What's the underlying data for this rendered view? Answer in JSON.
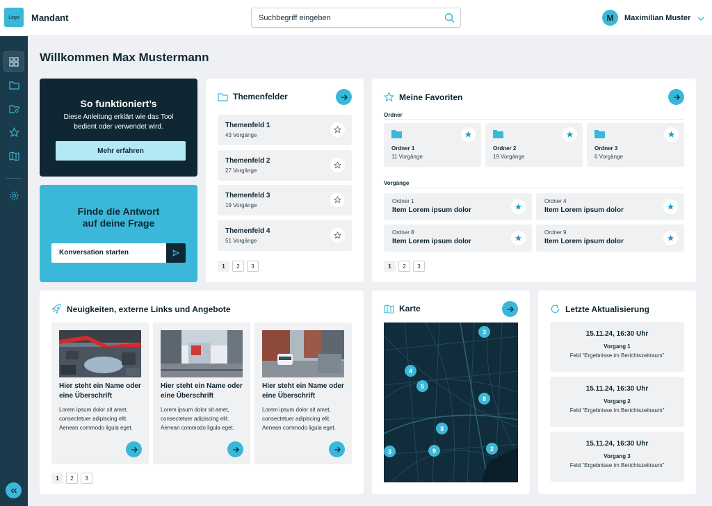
{
  "header": {
    "logo": "Logo",
    "mandant": "Mandant",
    "search_placeholder": "Suchbegriff eingeben",
    "user_initial": "M",
    "user_name": "Maximilian Muster"
  },
  "colors": {
    "accent": "#3bb8d9",
    "dark": "#0f2733",
    "sidebar": "#1a3b4b",
    "background": "#eef0f3"
  },
  "sidebar": {
    "items": [
      "dashboard-icon",
      "folder-icon",
      "folder-search-icon",
      "star-icon",
      "map-icon",
      "settings-icon"
    ],
    "active": "dashboard-icon"
  },
  "page_title": "Willkommen Max Mustermann",
  "howto": {
    "title": "So funktioniert’s",
    "text": "Diese Anleitung erklärt wie das Tool bedient oder verwendet wird.",
    "button": "Mehr erfahren"
  },
  "answer": {
    "title_line1": "Finde die Antwort",
    "title_line2": "auf deine Frage",
    "input_label": "Konversation starten"
  },
  "themenfelder": {
    "title": "Themenfelder",
    "items": [
      {
        "title": "Themenfeld 1",
        "sub": "43 Vorgänge"
      },
      {
        "title": "Themenfeld 2",
        "sub": "27 Vorgänge"
      },
      {
        "title": "Themenfeld 3",
        "sub": "19 Vorgänge"
      },
      {
        "title": "Themenfeld 4",
        "sub": "51 Vorgänge"
      }
    ],
    "pages": [
      "1",
      "2",
      "3"
    ]
  },
  "favoriten": {
    "title": "Meine Favoriten",
    "ordner_label": "Ordner",
    "ordner": [
      {
        "title": "Ordner 1",
        "sub": "11 Vorgänge"
      },
      {
        "title": "Ordner 2",
        "sub": "19 Vorgänge"
      },
      {
        "title": "Ordner 3",
        "sub": "6 Vorgänge"
      }
    ],
    "vorgaenge_label": "Vorgänge",
    "vorgaenge": [
      {
        "ordner": "Ordner 1",
        "title": "Item Lorem ipsum dolor"
      },
      {
        "ordner": "Ordner 4",
        "title": "Item Lorem ipsum dolor"
      },
      {
        "ordner": "Ordner 8",
        "title": "Item Lorem ipsum dolor"
      },
      {
        "ordner": "Ordner 9",
        "title": "Item Lorem ipsum dolor"
      }
    ],
    "pages": [
      "1",
      "2",
      "3"
    ]
  },
  "news": {
    "title": "Neuigkeiten, externe Links und Angebote",
    "items": [
      {
        "heading": "Hier steht ein Name oder eine Überschrift",
        "text": "Lorem ipsum dolor sit amet, consectetuer adipiscing elit. Aenean commodo ligula eget."
      },
      {
        "heading": "Hier steht ein Name oder eine Überschrift",
        "text": "Lorem ipsum dolor sit amet, consectetuer adipiscing elit. Aenean commodo ligula eget."
      },
      {
        "heading": "Hier steht ein Name oder eine Überschrift",
        "text": "Lorem ipsum dolor sit amet, consectetuer adipiscing elit. Aenean commodo ligula eget."
      }
    ],
    "pages": [
      "1",
      "2",
      "3"
    ]
  },
  "karte": {
    "title": "Karte",
    "markers": [
      "3",
      "4",
      "5",
      "8",
      "3",
      "9",
      "2",
      "3"
    ]
  },
  "updates": {
    "title": "Letzte Aktualisierung",
    "items": [
      {
        "date": "15.11.24, 16:30 Uhr",
        "vorgang": "Vorgang 1",
        "feld": "Feld “Ergebnisse im Berichtszeitraum”"
      },
      {
        "date": "15.11.24, 16:30 Uhr",
        "vorgang": "Vorgang 2",
        "feld": "Feld “Ergebnisse im Berichtszeitraum”"
      },
      {
        "date": "15.11.24, 16:30 Uhr",
        "vorgang": "Vorgang 3",
        "feld": "Feld “Ergebnisse im Berichtszeitraum”"
      }
    ]
  }
}
